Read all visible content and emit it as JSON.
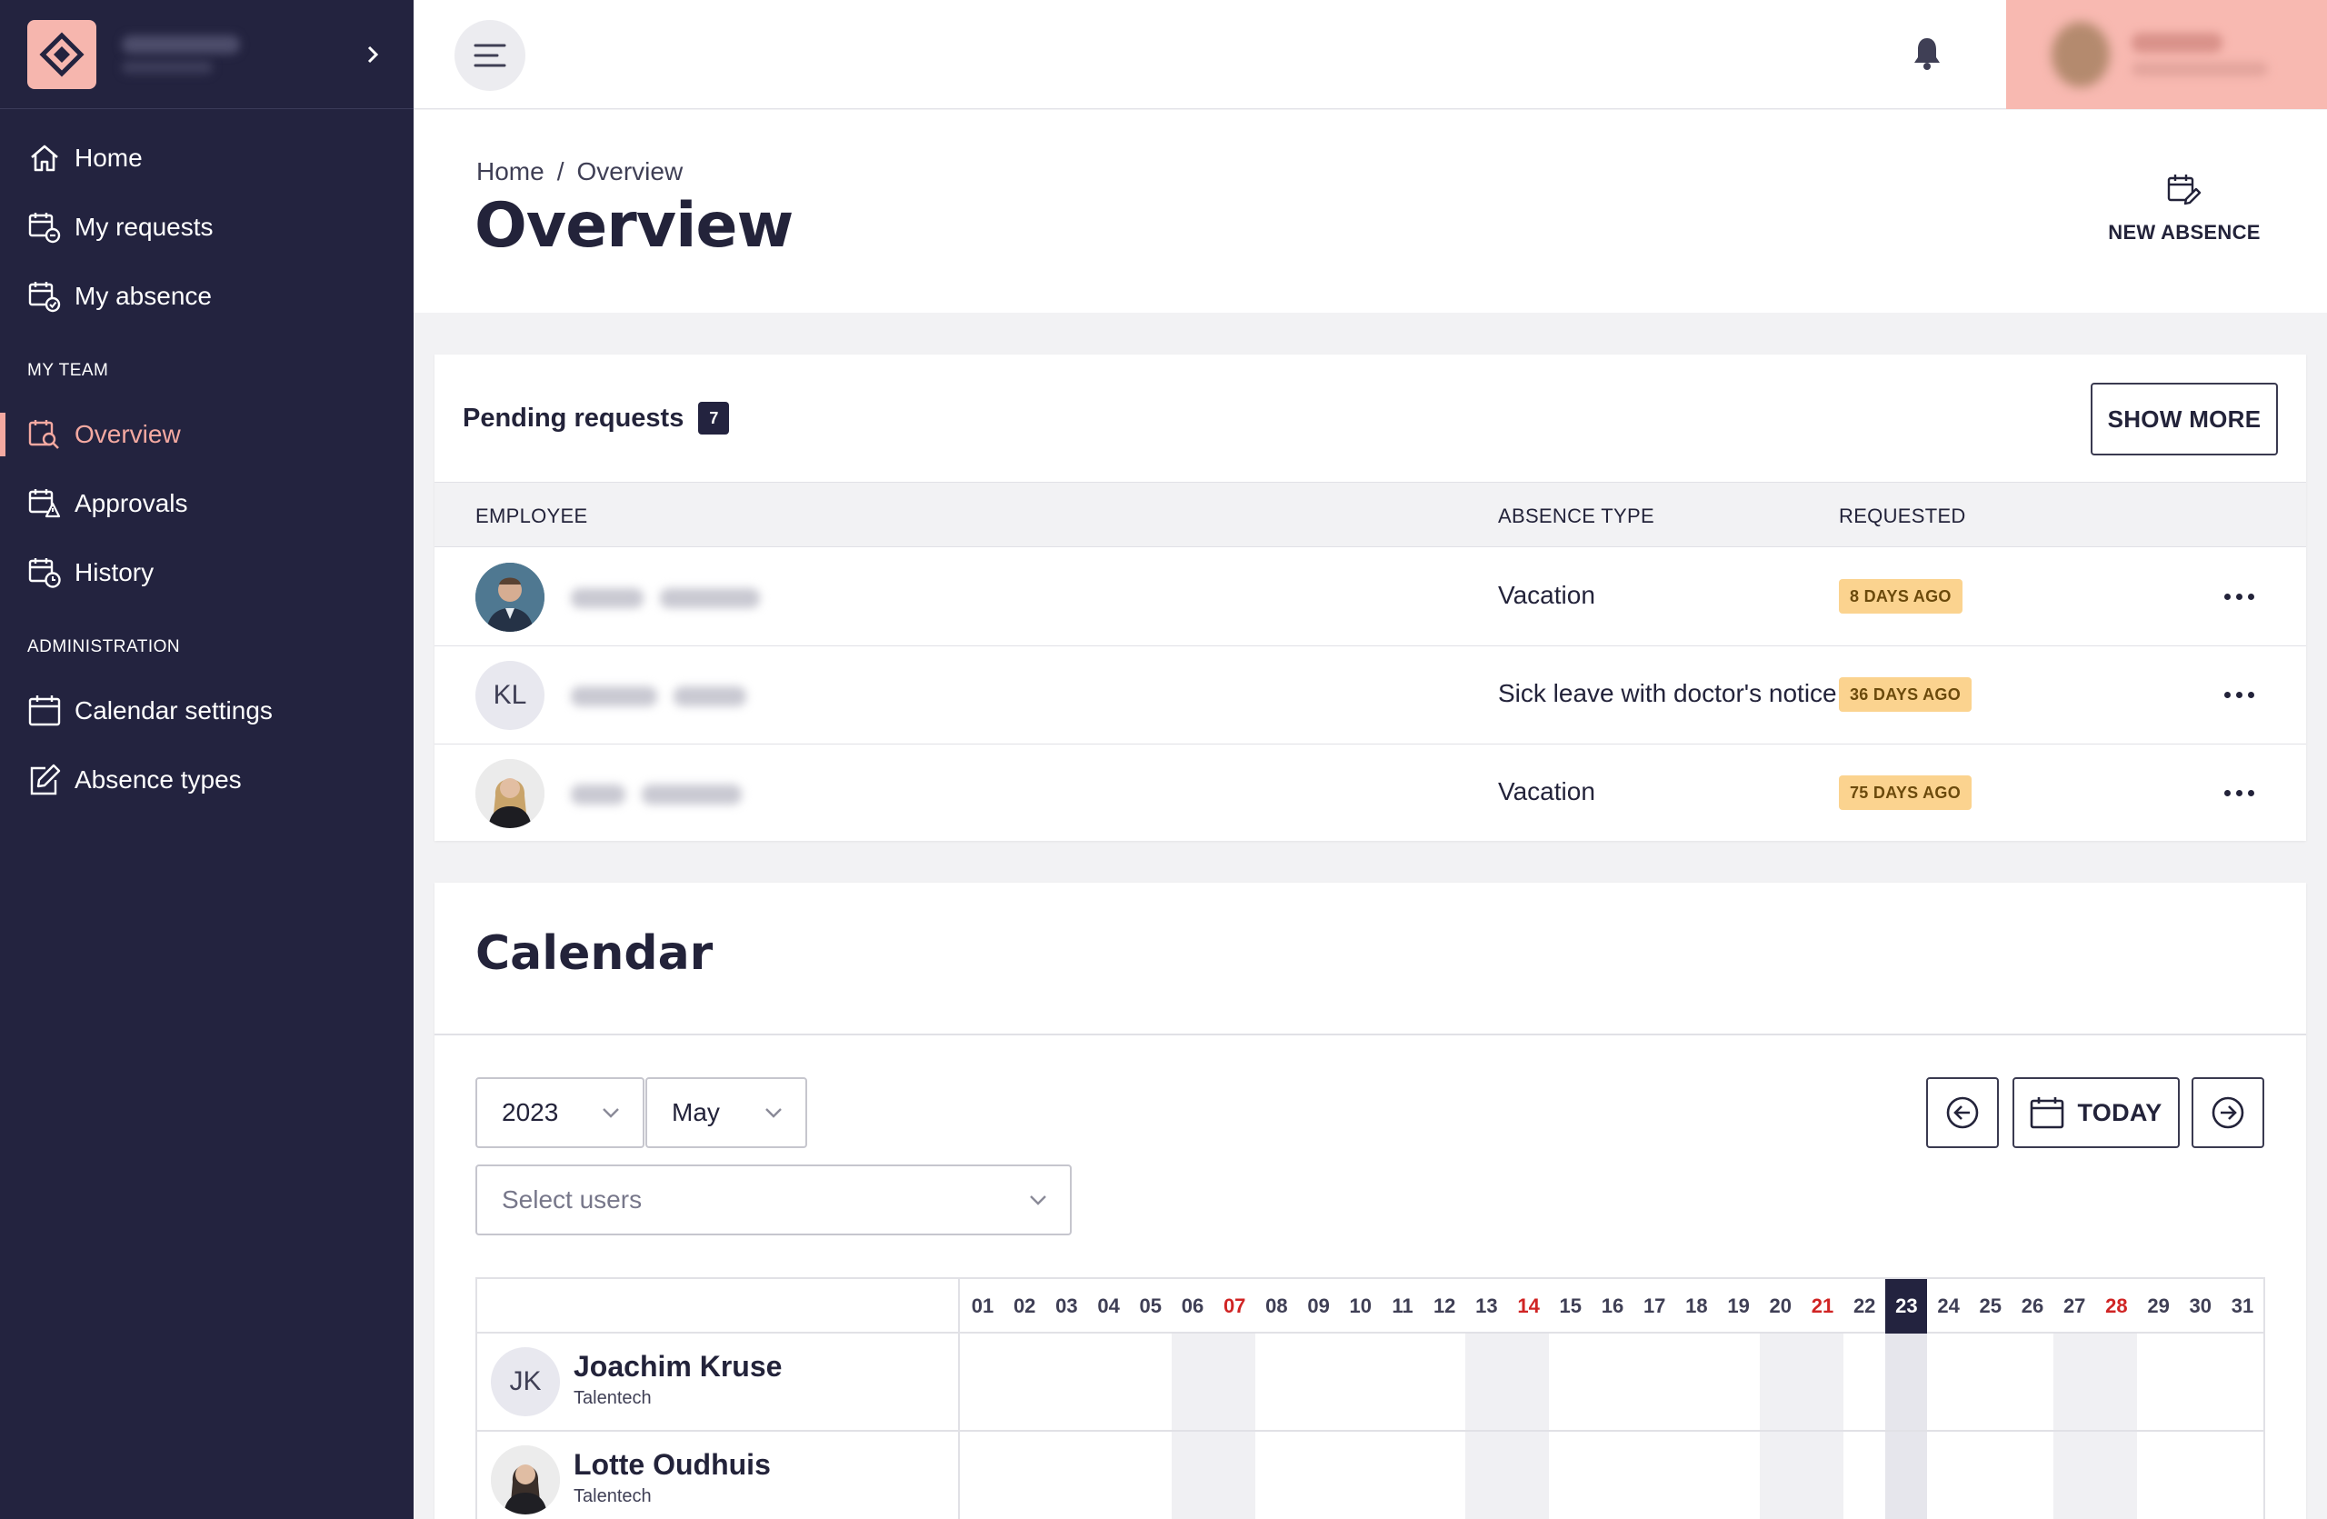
{
  "sidebar": {
    "items": [
      {
        "label": "Home",
        "icon": "home-icon"
      },
      {
        "label": "My requests",
        "icon": "calendar-refresh-icon"
      },
      {
        "label": "My absence",
        "icon": "calendar-check-icon"
      }
    ],
    "team_label": "MY TEAM",
    "team_items": [
      {
        "label": "Overview",
        "icon": "calendar-search-icon",
        "active": true
      },
      {
        "label": "Approvals",
        "icon": "calendar-alert-icon"
      },
      {
        "label": "History",
        "icon": "calendar-clock-icon"
      }
    ],
    "admin_label": "ADMINISTRATION",
    "admin_items": [
      {
        "label": "Calendar settings",
        "icon": "calendar-icon"
      },
      {
        "label": "Absence types",
        "icon": "edit-icon"
      }
    ]
  },
  "header": {
    "breadcrumb": [
      "Home",
      "Overview"
    ],
    "breadcrumb_sep": "/",
    "title": "Overview",
    "new_absence_label": "NEW ABSENCE"
  },
  "pending": {
    "title": "Pending requests",
    "count": "7",
    "show_more": "SHOW MORE",
    "columns": [
      "EMPLOYEE",
      "ABSENCE TYPE",
      "REQUESTED"
    ],
    "rows": [
      {
        "initials": "",
        "type": "Vacation",
        "requested": "8 DAYS AGO"
      },
      {
        "initials": "KL",
        "type": "Sick leave with doctor's notice",
        "requested": "36 DAYS AGO"
      },
      {
        "initials": "",
        "type": "Vacation",
        "requested": "75 DAYS AGO"
      }
    ]
  },
  "calendar": {
    "title": "Calendar",
    "year": "2023",
    "month": "May",
    "select_users_placeholder": "Select users",
    "today_label": "TODAY",
    "days": [
      "01",
      "02",
      "03",
      "04",
      "05",
      "06",
      "07",
      "08",
      "09",
      "10",
      "11",
      "12",
      "13",
      "14",
      "15",
      "16",
      "17",
      "18",
      "19",
      "20",
      "21",
      "22",
      "23",
      "24",
      "25",
      "26",
      "27",
      "28",
      "29",
      "30",
      "31"
    ],
    "red_days": [
      "07",
      "14",
      "21",
      "28"
    ],
    "today_day": "23",
    "employees": [
      {
        "initials": "JK",
        "name": "Joachim Kruse",
        "org": "Talentech"
      },
      {
        "initials": "",
        "name": "Lotte Oudhuis",
        "org": "Talentech"
      }
    ]
  },
  "colors": {
    "sidebar_bg": "#23233f",
    "accent_pink": "#f4a9a1",
    "badge_amber": "#fbd38f",
    "holiday_red": "#d02424"
  }
}
